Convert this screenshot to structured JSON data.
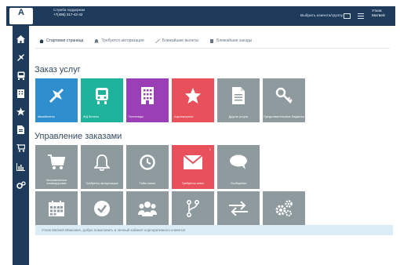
{
  "topbar": {
    "logo_letter": "A",
    "logo_text": "",
    "support_title": "Служба поддержки",
    "support_link": "",
    "support_phone": "+7(495) 317-42-42",
    "client_select_label": "Выбрать клиента/группу",
    "user_name": "Утков Матвей",
    "user_role": ""
  },
  "sidebar": {
    "items": [
      {
        "icon": "home-icon"
      },
      {
        "icon": "airplane-icon"
      },
      {
        "icon": "train-icon"
      },
      {
        "icon": "hotel-icon"
      },
      {
        "icon": "star-icon"
      },
      {
        "icon": "document-icon"
      },
      {
        "icon": "cart-icon"
      },
      {
        "icon": "chart-icon"
      },
      {
        "icon": "settings-icon"
      }
    ]
  },
  "breadcrumbs": [
    {
      "label": "Стартовая страница",
      "icon": "home-icon",
      "active": true
    },
    {
      "label": "Требуется авторизация",
      "icon": "bell-icon",
      "active": false
    },
    {
      "label": "Ближайшие вылеты",
      "icon": "airplane-icon",
      "active": false
    },
    {
      "label": "Ближайшие заезды",
      "icon": "hotel-icon",
      "active": false
    }
  ],
  "sections": {
    "services_title": "Заказ услуг",
    "orders_title": "Управление заказами"
  },
  "colors": {
    "blue": "#2f8fce",
    "teal": "#1fb39b",
    "purple": "#9b3fb6",
    "red": "#e8505b",
    "gray": "#8e9a9d",
    "dark_navy": "#1e3b5c"
  },
  "services": [
    {
      "label": "Авиабилеты",
      "icon": "airplane-icon",
      "color": "#2f8fce",
      "align": "left"
    },
    {
      "label": "ЖД билеты",
      "icon": "train-icon",
      "color": "#1fb39b",
      "align": "left"
    },
    {
      "label": "Гостиницы",
      "icon": "hotel-icon",
      "color": "#9b3fb6",
      "align": "left"
    },
    {
      "label": "Аэроэкспресс",
      "icon": "star-icon",
      "color": "#e8505b",
      "align": "left"
    },
    {
      "label": "Другие услуги",
      "icon": "document-icon",
      "color": "#8e9a9d",
      "align": "center"
    },
    {
      "label": "Представительские бюджеты",
      "icon": "key-icon",
      "color": "#8e9a9d",
      "align": "center"
    }
  ],
  "orders_row1": [
    {
      "label": "Неоплаченные командировки",
      "icon": "cart-icon",
      "color": "#8e9a9d",
      "badge": ""
    },
    {
      "label": "Требуется авторизация",
      "icon": "bell-icon",
      "color": "#8e9a9d",
      "badge": ""
    },
    {
      "label": "Тайм-лимит",
      "icon": "clock-icon",
      "color": "#8e9a9d",
      "badge": ""
    },
    {
      "label": "Требуется ответ",
      "icon": "envelope-icon",
      "color": "#e8505b",
      "badge": "1"
    },
    {
      "label": "Сообщения",
      "icon": "chat-icon",
      "color": "#8e9a9d",
      "badge": ""
    }
  ],
  "orders_row2": [
    {
      "label": "Календарь поездок",
      "icon": "calendar-icon",
      "color": "#8e9a9d"
    },
    {
      "label": "Путевые листы",
      "icon": "check-icon",
      "color": "#8e9a9d"
    },
    {
      "label": "Персонал путешественники",
      "icon": "people-icon",
      "color": "#8e9a9d"
    },
    {
      "label": "Бюджетирование",
      "icon": "branch-icon",
      "color": "#8e9a9d"
    },
    {
      "label": "Обмен/возврат",
      "icon": "exchange-icon",
      "color": "#8e9a9d"
    },
    {
      "label": "Прочие настройки",
      "icon": "gears-icon",
      "color": "#8e9a9d"
    }
  ],
  "welcome_text": "Утков Матвей Иванович, добро пожаловать в личный кабинет корпоративного клиента!"
}
